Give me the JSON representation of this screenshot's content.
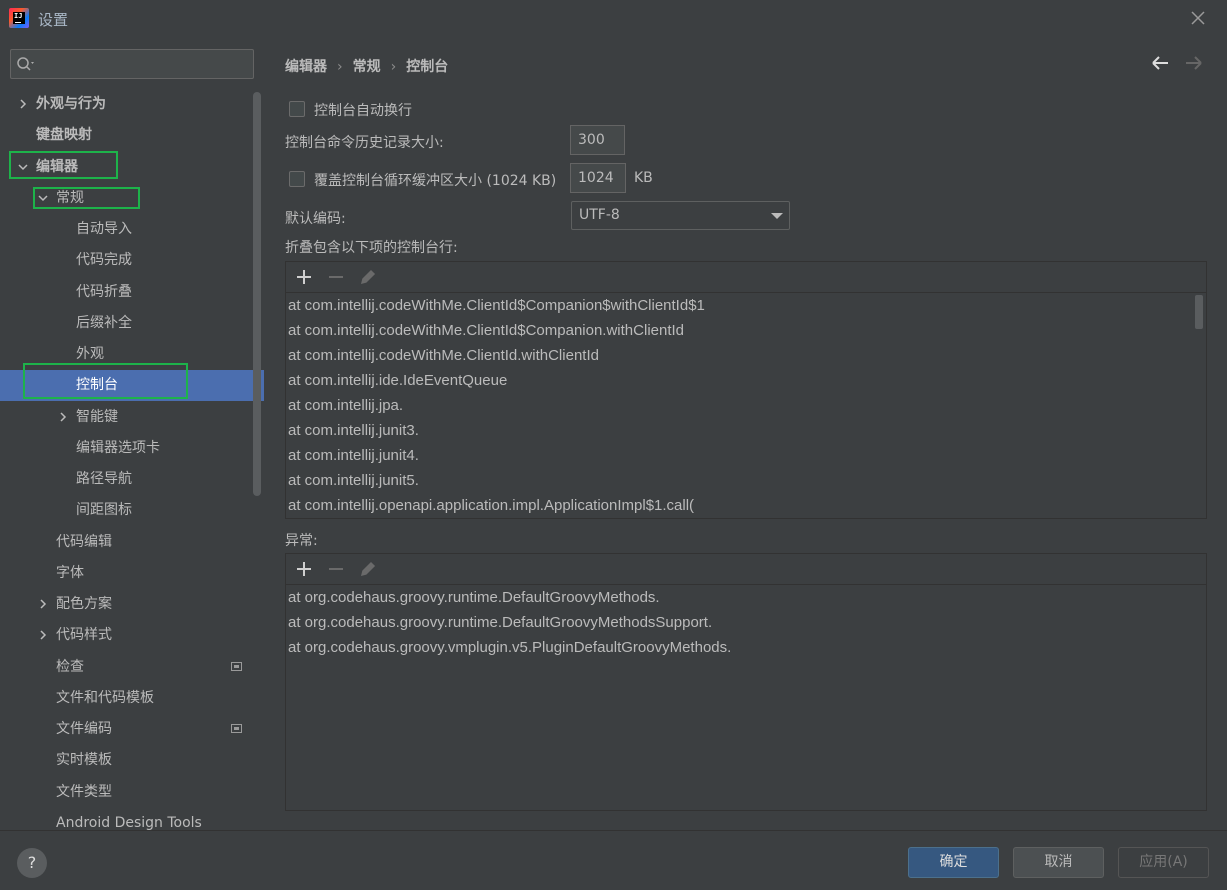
{
  "window": {
    "title": "设置",
    "logo_text": "IJ"
  },
  "search": {
    "placeholder": "",
    "value": ""
  },
  "sidebar": {
    "items": [
      {
        "label": "外观与行为",
        "arrow": "right"
      },
      {
        "label": "键盘映射"
      },
      {
        "label": "编辑器",
        "arrow": "down"
      },
      {
        "label": "常规",
        "arrow": "down"
      },
      {
        "label": "自动导入"
      },
      {
        "label": "代码完成"
      },
      {
        "label": "代码折叠"
      },
      {
        "label": "后缀补全"
      },
      {
        "label": "外观"
      },
      {
        "label": "控制台",
        "selected": true
      },
      {
        "label": "智能键",
        "arrow": "right"
      },
      {
        "label": "编辑器选项卡"
      },
      {
        "label": "路径导航"
      },
      {
        "label": "间距图标"
      },
      {
        "label": "代码编辑"
      },
      {
        "label": "字体"
      },
      {
        "label": "配色方案",
        "arrow": "right"
      },
      {
        "label": "代码样式",
        "arrow": "right"
      },
      {
        "label": "检查",
        "badge": true
      },
      {
        "label": "文件和代码模板"
      },
      {
        "label": "文件编码",
        "badge": true
      },
      {
        "label": "实时模板"
      },
      {
        "label": "文件类型"
      },
      {
        "label": "Android Design Tools"
      }
    ]
  },
  "breadcrumb": {
    "part1": "编辑器",
    "part2": "常规",
    "part3": "控制台",
    "separator": "›"
  },
  "settings": {
    "soft_wrap_label": "控制台自动换行",
    "history_size_label": "控制台命令历史记录大小:",
    "history_size_value": "300",
    "override_buffer_label": "覆盖控制台循环缓冲区大小 (1024 KB)",
    "buffer_size_value": "1024",
    "buffer_unit": "KB",
    "default_encoding_label": "默认编码:",
    "default_encoding_value": "UTF-8",
    "fold_lines_label": "折叠包含以下项的控制台行:",
    "exceptions_label": "异常:"
  },
  "fold_lines": [
    "at com.intellij.codeWithMe.ClientId$Companion$withClientId$1",
    "at com.intellij.codeWithMe.ClientId$Companion.withClientId",
    "at com.intellij.codeWithMe.ClientId.withClientId",
    "at com.intellij.ide.IdeEventQueue",
    "at com.intellij.jpa.",
    "at com.intellij.junit3.",
    "at com.intellij.junit4.",
    "at com.intellij.junit5.",
    "at com.intellij.openapi.application.impl.ApplicationImpl$1.call("
  ],
  "exceptions": [
    "at org.codehaus.groovy.runtime.DefaultGroovyMethods.",
    "at org.codehaus.groovy.runtime.DefaultGroovyMethodsSupport.",
    "at org.codehaus.groovy.vmplugin.v5.PluginDefaultGroovyMethods."
  ],
  "buttons": {
    "help": "?",
    "ok": "确定",
    "cancel": "取消",
    "apply": "应用(A)"
  },
  "colors": {
    "background": "#3c3f41",
    "selection": "#4b6eaf",
    "highlight_box": "#1db34a",
    "ok_button": "#365880"
  },
  "icons": [
    "search-icon",
    "close-icon",
    "back-arrow-icon",
    "forward-arrow-icon",
    "add-icon",
    "remove-icon",
    "edit-icon",
    "chevron-right-icon",
    "chevron-down-icon",
    "project-badge-icon",
    "help-icon"
  ]
}
